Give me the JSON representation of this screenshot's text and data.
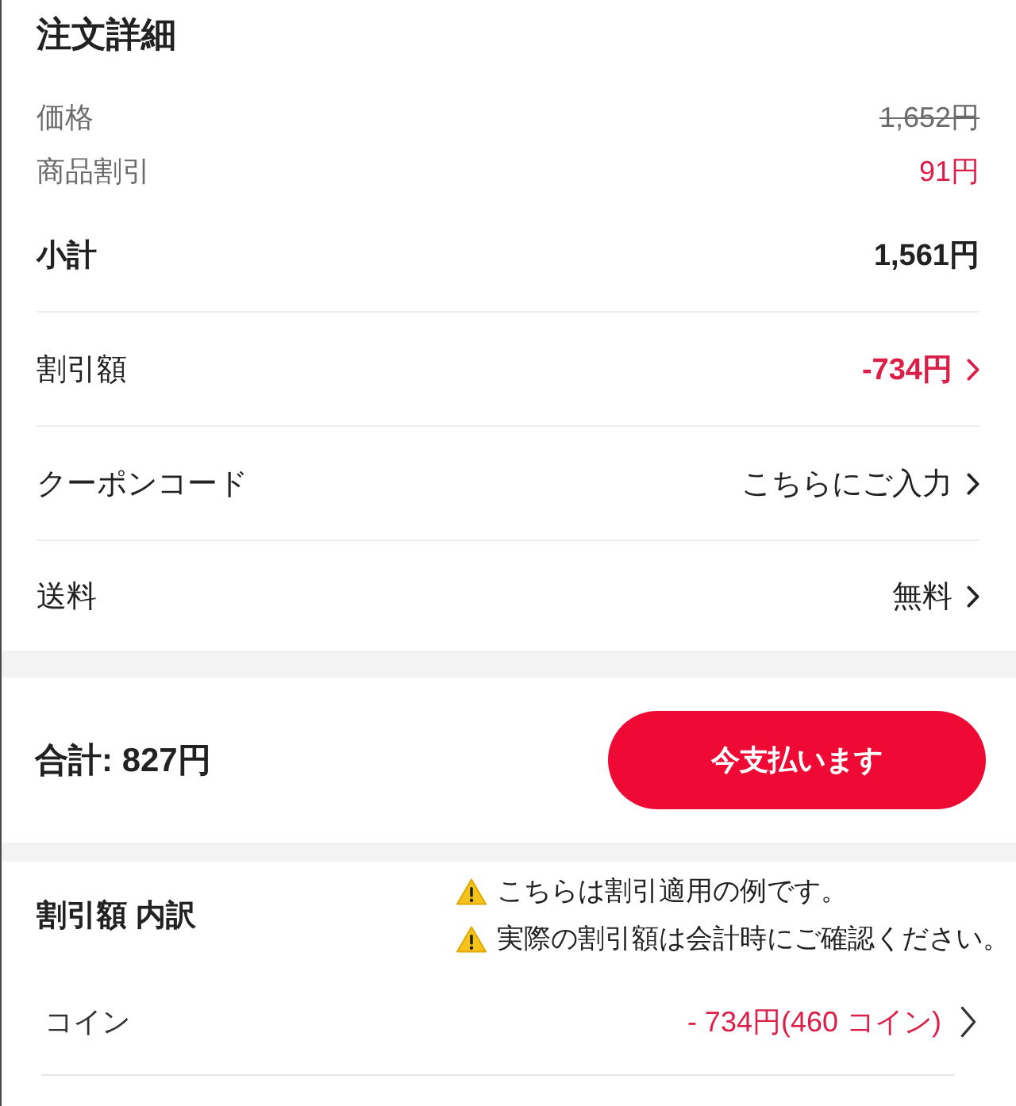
{
  "order_details": {
    "title": "注文詳細",
    "rows": [
      {
        "kind": "muted",
        "label": "価格",
        "value": "1,652円",
        "strikethrough": true,
        "discount": false
      },
      {
        "kind": "muted",
        "label": "商品割引",
        "value": "91円",
        "strikethrough": false,
        "discount": true
      },
      {
        "kind": "summary",
        "label": "小計",
        "value": "1,561円",
        "strikethrough": false,
        "discount": false
      },
      {
        "kind": "link",
        "label": "割引額",
        "value": "-734円",
        "strikethrough": false,
        "discount": true
      },
      {
        "kind": "link",
        "label": "クーポンコード",
        "value": "こちらにご入力",
        "strikethrough": false,
        "discount": false
      },
      {
        "kind": "link",
        "label": "送料",
        "value": "無料",
        "strikethrough": false,
        "discount": false
      }
    ]
  },
  "checkout": {
    "total": "合計: 827円",
    "pay_button": "今支払います"
  },
  "discount_breakdown": {
    "title": "割引額 内訳",
    "notes": [
      "こちらは割引適用の例です。",
      "実際の割引額は会計時にご確認ください。"
    ],
    "rows": [
      {
        "label": "コイン",
        "value": "- 734円(460 コイン)",
        "discount": true
      }
    ]
  }
}
